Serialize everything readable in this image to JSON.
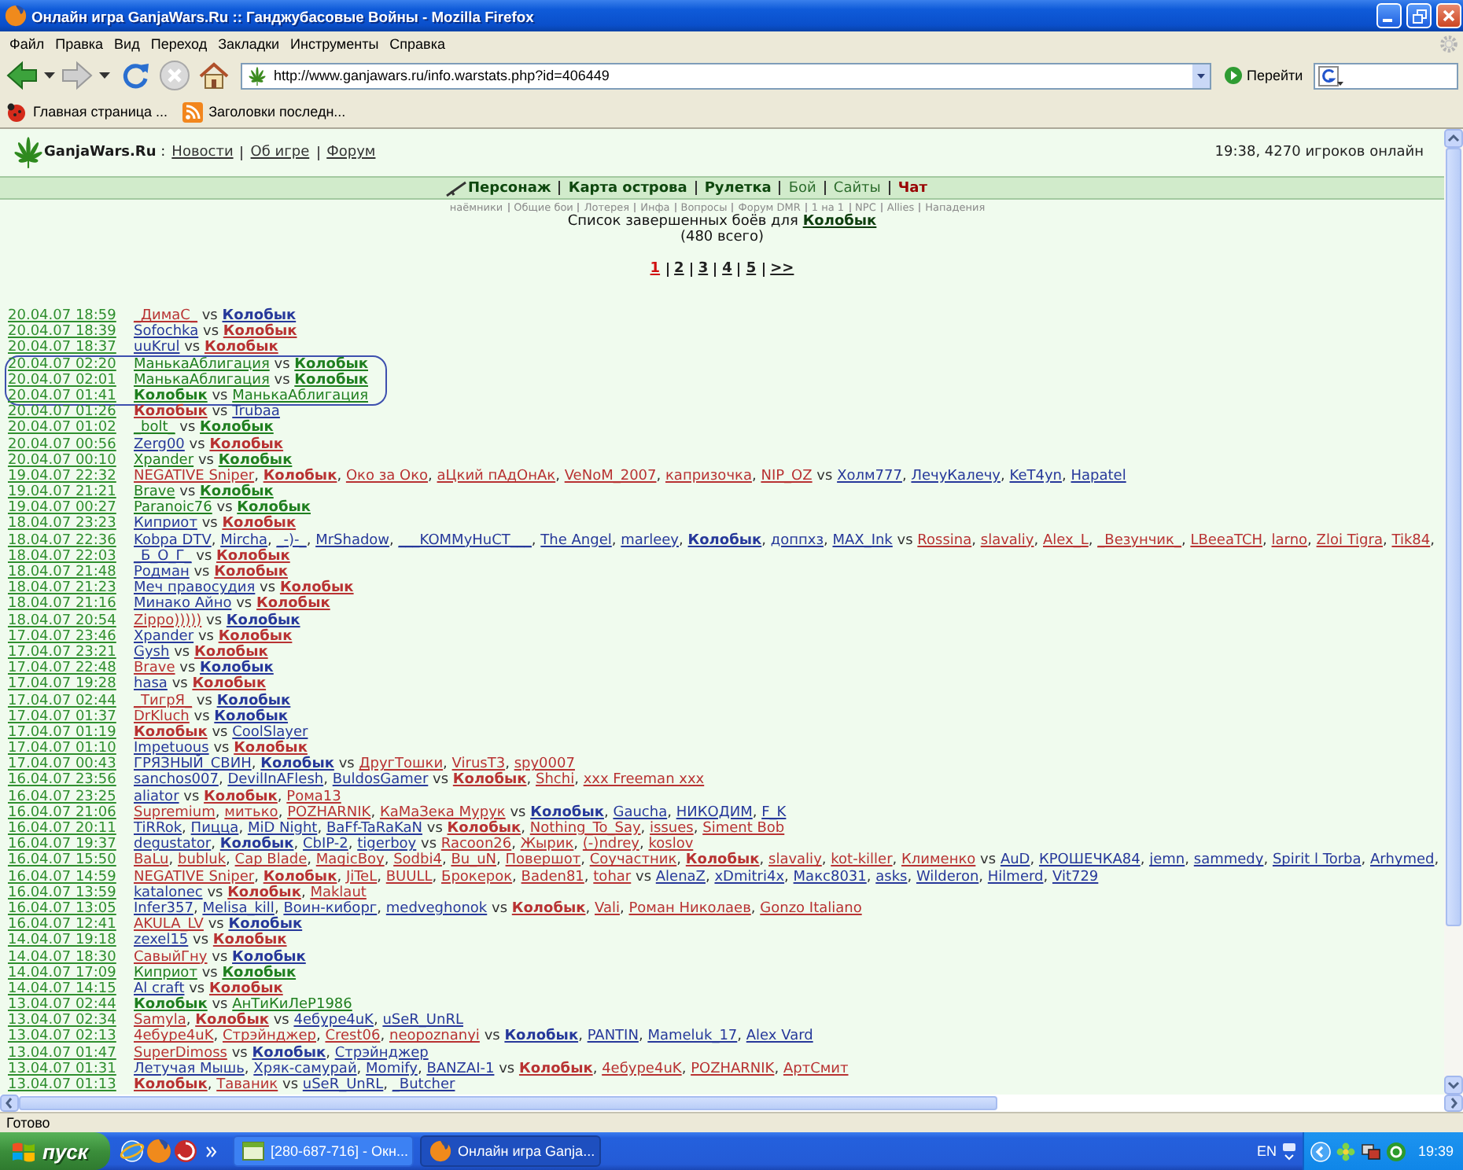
{
  "window": {
    "title": "Онлайн игра GanjaWars.Ru :: Ганджубасовые Войны - Mozilla Firefox"
  },
  "menu": [
    "Файл",
    "Правка",
    "Вид",
    "Переход",
    "Закладки",
    "Инструменты",
    "Справка"
  ],
  "toolbar": {
    "url": "http://www.ganjawars.ru/info.warstats.php?id=406449",
    "go": "Перейти"
  },
  "bookmarks": [
    {
      "label": "Главная страница ...",
      "kind": "page"
    },
    {
      "label": "Заголовки последн...",
      "kind": "feed"
    }
  ],
  "header": {
    "brand": "**GanjaWars.Ru** :",
    "links": [
      "Новости",
      "Об игре",
      "Форум"
    ],
    "online": "19:38, 4270 игроков онлайн"
  },
  "nav": [
    {
      "label": "Персонаж",
      "bold": true,
      "color": "#0e470e"
    },
    {
      "label": "Карта острова",
      "bold": true,
      "color": "#0e470e"
    },
    {
      "label": "Рулетка",
      "bold": true,
      "color": "#0e470e"
    },
    {
      "label": "Бой",
      "bold": false,
      "color": "#2b6b2b"
    },
    {
      "label": "Сайты",
      "bold": false,
      "color": "#2b6b2b"
    },
    {
      "label": "Чат",
      "bold": true,
      "color": "#990000"
    }
  ],
  "subnav": [
    "наёмники",
    "Общие бои",
    "Лотерея",
    "Инфа",
    "Вопросы",
    "Форум DMR",
    "1 на 1",
    "NPC",
    "Allies",
    "Нападения"
  ],
  "list_title": {
    "text": "Список завершенных боёв для",
    "player": "Колобык"
  },
  "total": "(480 всего)",
  "pages": [
    {
      "label": "1",
      "selected": true
    },
    {
      "label": "2",
      "selected": false
    },
    {
      "label": "3",
      "selected": false
    },
    {
      "label": "4",
      "selected": false
    },
    {
      "label": "5",
      "selected": false
    },
    {
      "label": ">>",
      "selected": false
    }
  ],
  "battles": [
    {
      "date": "20.04.07 18:59",
      "circled": false,
      "team_1": [
        {
          "name": "_ДимаС_",
          "color": "#b83232",
          "bold": false
        }
      ],
      "vs": "vs",
      "team_2": [
        {
          "name": "Колобык",
          "color": "#26389a",
          "bold": true
        }
      ]
    },
    {
      "date": "20.04.07 18:39",
      "circled": false,
      "team_1": [
        {
          "name": "Sofochka",
          "color": "#26389a",
          "bold": false
        }
      ],
      "vs": "vs",
      "team_2": [
        {
          "name": "Колобык",
          "color": "#b83232",
          "bold": true
        }
      ]
    },
    {
      "date": "20.04.07 18:37",
      "circled": false,
      "team_1": [
        {
          "name": "uuKrul",
          "color": "#26389a",
          "bold": false
        }
      ],
      "vs": "vs",
      "team_2": [
        {
          "name": "Колобык",
          "color": "#b83232",
          "bold": true
        }
      ]
    },
    {
      "date": "20.04.07 02:20",
      "circled": true,
      "team_1": [
        {
          "name": "МанькаАблигация",
          "color": "#1f7f1f",
          "bold": false
        }
      ],
      "vs": "vs",
      "team_2": [
        {
          "name": "Колобык",
          "color": "#1f7f1f",
          "bold": true
        }
      ]
    },
    {
      "date": "20.04.07 02:01",
      "circled": true,
      "team_1": [
        {
          "name": "МанькаАблигация",
          "color": "#1f7f1f",
          "bold": false
        }
      ],
      "vs": "vs",
      "team_2": [
        {
          "name": "Колобык",
          "color": "#1f7f1f",
          "bold": true
        }
      ]
    },
    {
      "date": "20.04.07 01:41",
      "circled": true,
      "team_1": [
        {
          "name": "Колобык",
          "color": "#1f7f1f",
          "bold": true
        }
      ],
      "vs": "vs",
      "team_2": [
        {
          "name": "МанькаАблигация",
          "color": "#1f7f1f",
          "bold": false
        }
      ]
    },
    {
      "date": "20.04.07 01:26",
      "circled": false,
      "team_1": [
        {
          "name": "Колобык",
          "color": "#b83232",
          "bold": true
        }
      ],
      "vs": "vs",
      "team_2": [
        {
          "name": "Trubaa",
          "color": "#26389a",
          "bold": false
        }
      ]
    },
    {
      "date": "20.04.07 01:02",
      "circled": false,
      "team_1": [
        {
          "name": "_bolt_",
          "color": "#1f7f1f",
          "bold": false
        }
      ],
      "vs": "vs",
      "team_2": [
        {
          "name": "Колобык",
          "color": "#1f7f1f",
          "bold": true
        }
      ]
    },
    {
      "date": "20.04.07 00:56",
      "circled": false,
      "team_1": [
        {
          "name": "Zerg00",
          "color": "#26389a",
          "bold": false
        }
      ],
      "vs": "vs",
      "team_2": [
        {
          "name": "Колобык",
          "color": "#b83232",
          "bold": true
        }
      ]
    },
    {
      "date": "20.04.07 00:10",
      "circled": false,
      "team_1": [
        {
          "name": "Xpander",
          "color": "#1f7f1f",
          "bold": false
        }
      ],
      "vs": "vs",
      "team_2": [
        {
          "name": "Колобык",
          "color": "#1f7f1f",
          "bold": true
        }
      ]
    },
    {
      "date": "19.04.07 22:32",
      "circled": false,
      "team_1": [
        {
          "name": "NEGATIVE Sniper",
          "color": "#b83232",
          "bold": false,
          "sep": ","
        },
        {
          "name": "Колобык",
          "color": "#b83232",
          "bold": true,
          "sep": ","
        },
        {
          "name": "Око за Око",
          "color": "#b83232",
          "bold": false,
          "sep": ","
        },
        {
          "name": "аЦкий пАдОнАк",
          "color": "#b83232",
          "bold": false,
          "sep": ","
        },
        {
          "name": "VeNoM_2007",
          "color": "#b83232",
          "bold": false,
          "sep": ","
        },
        {
          "name": "капризочка",
          "color": "#b83232",
          "bold": false,
          "sep": ","
        },
        {
          "name": "NIP_OZ",
          "color": "#b83232",
          "bold": false
        }
      ],
      "vs": "vs",
      "team_2": [
        {
          "name": "Холм777",
          "color": "#26389a",
          "bold": false,
          "sep": ","
        },
        {
          "name": "ЛечуКалечу",
          "color": "#26389a",
          "bold": false,
          "sep": ","
        },
        {
          "name": "KeT4yn",
          "color": "#26389a",
          "bold": false,
          "sep": ","
        },
        {
          "name": "Hapatel",
          "color": "#26389a",
          "bold": false
        }
      ]
    },
    {
      "date": "19.04.07 21:21",
      "circled": false,
      "team_1": [
        {
          "name": "Brave",
          "color": "#1f7f1f",
          "bold": false
        }
      ],
      "vs": "vs",
      "team_2": [
        {
          "name": "Колобык",
          "color": "#1f7f1f",
          "bold": true
        }
      ]
    },
    {
      "date": "19.04.07 00:27",
      "circled": false,
      "team_1": [
        {
          "name": "Paranoic76",
          "color": "#1f7f1f",
          "bold": false
        }
      ],
      "vs": "vs",
      "team_2": [
        {
          "name": "Колобык",
          "color": "#1f7f1f",
          "bold": true
        }
      ]
    },
    {
      "date": "18.04.07 23:23",
      "circled": false,
      "team_1": [
        {
          "name": "Киприот",
          "color": "#26389a",
          "bold": false
        }
      ],
      "vs": "vs",
      "team_2": [
        {
          "name": "Колобык",
          "color": "#b83232",
          "bold": true
        }
      ]
    },
    {
      "date": "18.04.07 22:36",
      "circled": false,
      "team_1": [
        {
          "name": "Kobpa DTV",
          "color": "#26389a",
          "bold": false,
          "sep": ","
        },
        {
          "name": "Mircha",
          "color": "#26389a",
          "bold": false,
          "sep": ","
        },
        {
          "name": "_-)-_",
          "color": "#26389a",
          "bold": false,
          "sep": ","
        },
        {
          "name": "MrShadow",
          "color": "#26389a",
          "bold": false,
          "sep": ","
        },
        {
          "name": "___KOMMyHuCT___",
          "color": "#26389a",
          "bold": false,
          "sep": ","
        },
        {
          "name": "The Angel",
          "color": "#26389a",
          "bold": false,
          "sep": ","
        },
        {
          "name": "marleey",
          "color": "#26389a",
          "bold": false,
          "sep": ","
        },
        {
          "name": "Колобык",
          "color": "#26389a",
          "bold": true,
          "sep": ","
        },
        {
          "name": "доппхз",
          "color": "#26389a",
          "bold": false,
          "sep": ","
        },
        {
          "name": "MAX_Ink",
          "color": "#26389a",
          "bold": false
        }
      ],
      "vs": "vs",
      "team_2": [
        {
          "name": "Rossina",
          "color": "#b83232",
          "bold": false,
          "sep": ","
        },
        {
          "name": "slavaliy",
          "color": "#b83232",
          "bold": false,
          "sep": ","
        },
        {
          "name": "Alex_L",
          "color": "#b83232",
          "bold": false,
          "sep": ","
        },
        {
          "name": "_Везунчик_",
          "color": "#b83232",
          "bold": false,
          "sep": ","
        },
        {
          "name": "LBeeaTCH",
          "color": "#b83232",
          "bold": false,
          "sep": ","
        },
        {
          "name": "larno",
          "color": "#b83232",
          "bold": false,
          "sep": ","
        },
        {
          "name": "Zloi Tigra",
          "color": "#b83232",
          "bold": false,
          "sep": ","
        },
        {
          "name": "Tik84",
          "color": "#b83232",
          "bold": false,
          "sep": ","
        }
      ]
    },
    {
      "date": "18.04.07 22:03",
      "circled": false,
      "team_1": [
        {
          "name": "_Б_О_Г_",
          "color": "#26389a",
          "bold": false
        }
      ],
      "vs": "vs",
      "team_2": [
        {
          "name": "Колобык",
          "color": "#b83232",
          "bold": true
        }
      ]
    },
    {
      "date": "18.04.07 21:48",
      "circled": false,
      "team_1": [
        {
          "name": "Родман",
          "color": "#26389a",
          "bold": false
        }
      ],
      "vs": "vs",
      "team_2": [
        {
          "name": "Колобык",
          "color": "#b83232",
          "bold": true
        }
      ]
    },
    {
      "date": "18.04.07 21:23",
      "circled": false,
      "team_1": [
        {
          "name": "Меч правосудия",
          "color": "#26389a",
          "bold": false
        }
      ],
      "vs": "vs",
      "team_2": [
        {
          "name": "Колобык",
          "color": "#b83232",
          "bold": true
        }
      ]
    },
    {
      "date": "18.04.07 21:16",
      "circled": false,
      "team_1": [
        {
          "name": "Минако Айно",
          "color": "#26389a",
          "bold": false
        }
      ],
      "vs": "vs",
      "team_2": [
        {
          "name": "Колобык",
          "color": "#b83232",
          "bold": true
        }
      ]
    },
    {
      "date": "18.04.07 20:54",
      "circled": false,
      "team_1": [
        {
          "name": "Zippo)))))",
          "color": "#b83232",
          "bold": false
        }
      ],
      "vs": "vs",
      "team_2": [
        {
          "name": "Колобык",
          "color": "#26389a",
          "bold": true
        }
      ]
    },
    {
      "date": "17.04.07 23:46",
      "circled": false,
      "team_1": [
        {
          "name": "Xpander",
          "color": "#26389a",
          "bold": false
        }
      ],
      "vs": "vs",
      "team_2": [
        {
          "name": "Колобык",
          "color": "#b83232",
          "bold": true
        }
      ]
    },
    {
      "date": "17.04.07 23:21",
      "circled": false,
      "team_1": [
        {
          "name": "Gysh",
          "color": "#26389a",
          "bold": false
        }
      ],
      "vs": "vs",
      "team_2": [
        {
          "name": "Колобык",
          "color": "#b83232",
          "bold": true
        }
      ]
    },
    {
      "date": "17.04.07 22:48",
      "circled": false,
      "team_1": [
        {
          "name": "Brave",
          "color": "#b83232",
          "bold": false
        }
      ],
      "vs": "vs",
      "team_2": [
        {
          "name": "Колобык",
          "color": "#26389a",
          "bold": true
        }
      ]
    },
    {
      "date": "17.04.07 19:28",
      "circled": false,
      "team_1": [
        {
          "name": "hasa",
          "color": "#26389a",
          "bold": false
        }
      ],
      "vs": "vs",
      "team_2": [
        {
          "name": "Колобык",
          "color": "#b83232",
          "bold": true
        }
      ]
    },
    {
      "date": "17.04.07 02:44",
      "circled": false,
      "team_1": [
        {
          "name": "_ТигрЯ_",
          "color": "#b83232",
          "bold": false
        }
      ],
      "vs": "vs",
      "team_2": [
        {
          "name": "Колобык",
          "color": "#26389a",
          "bold": true
        }
      ]
    },
    {
      "date": "17.04.07 01:37",
      "circled": false,
      "team_1": [
        {
          "name": "DrKluch",
          "color": "#b83232",
          "bold": false
        }
      ],
      "vs": "vs",
      "team_2": [
        {
          "name": "Колобык",
          "color": "#26389a",
          "bold": true
        }
      ]
    },
    {
      "date": "17.04.07 01:19",
      "circled": false,
      "team_1": [
        {
          "name": "Колобык",
          "color": "#b83232",
          "bold": true
        }
      ],
      "vs": "vs",
      "team_2": [
        {
          "name": "CoolSlayer",
          "color": "#26389a",
          "bold": false
        }
      ]
    },
    {
      "date": "17.04.07 01:10",
      "circled": false,
      "team_1": [
        {
          "name": "Impetuous",
          "color": "#26389a",
          "bold": false
        }
      ],
      "vs": "vs",
      "team_2": [
        {
          "name": "Колобык",
          "color": "#b83232",
          "bold": true
        }
      ]
    },
    {
      "date": "17.04.07 00:43",
      "circled": false,
      "team_1": [
        {
          "name": "ГРЯЗНЫЙ_СВИН",
          "color": "#26389a",
          "bold": false,
          "sep": ","
        },
        {
          "name": "Колобык",
          "color": "#26389a",
          "bold": true
        }
      ],
      "vs": "vs",
      "team_2": [
        {
          "name": "ДругТошки",
          "color": "#b83232",
          "bold": false,
          "sep": ","
        },
        {
          "name": "VirusT3",
          "color": "#b83232",
          "bold": false,
          "sep": ","
        },
        {
          "name": "spy0007",
          "color": "#b83232",
          "bold": false
        }
      ]
    },
    {
      "date": "16.04.07 23:56",
      "circled": false,
      "team_1": [
        {
          "name": "sanchos007",
          "color": "#26389a",
          "bold": false,
          "sep": ","
        },
        {
          "name": "DevilInAFlesh",
          "color": "#26389a",
          "bold": false,
          "sep": ","
        },
        {
          "name": "BuldosGamer",
          "color": "#26389a",
          "bold": false
        }
      ],
      "vs": "vs",
      "team_2": [
        {
          "name": "Колобык",
          "color": "#b83232",
          "bold": true,
          "sep": ","
        },
        {
          "name": "Shchi",
          "color": "#b83232",
          "bold": false,
          "sep": ","
        },
        {
          "name": "xxx Freeman xxx",
          "color": "#b83232",
          "bold": false
        }
      ]
    },
    {
      "date": "16.04.07 23:25",
      "circled": false,
      "team_1": [
        {
          "name": "aliator",
          "color": "#26389a",
          "bold": false
        }
      ],
      "vs": "vs",
      "team_2": [
        {
          "name": "Колобык",
          "color": "#b83232",
          "bold": true,
          "sep": ","
        },
        {
          "name": "Рома13",
          "color": "#b83232",
          "bold": false
        }
      ]
    },
    {
      "date": "16.04.07 21:06",
      "circled": false,
      "team_1": [
        {
          "name": "Supremium",
          "color": "#b83232",
          "bold": false,
          "sep": ","
        },
        {
          "name": "митько",
          "color": "#b83232",
          "bold": false,
          "sep": ","
        },
        {
          "name": "POZHARNIK",
          "color": "#b83232",
          "bold": false,
          "sep": ","
        },
        {
          "name": "КаМаЗека Мурук",
          "color": "#b83232",
          "bold": false
        }
      ],
      "vs": "vs",
      "team_2": [
        {
          "name": "Колобык",
          "color": "#26389a",
          "bold": true,
          "sep": ","
        },
        {
          "name": "Gaucha",
          "color": "#26389a",
          "bold": false,
          "sep": ","
        },
        {
          "name": "НИКОДИМ",
          "color": "#26389a",
          "bold": false,
          "sep": ","
        },
        {
          "name": "F_K",
          "color": "#26389a",
          "bold": false
        }
      ]
    },
    {
      "date": "16.04.07 20:11",
      "circled": false,
      "team_1": [
        {
          "name": "TiRRok",
          "color": "#26389a",
          "bold": false,
          "sep": ","
        },
        {
          "name": "Пицца",
          "color": "#26389a",
          "bold": false,
          "sep": ","
        },
        {
          "name": "MiD Night",
          "color": "#26389a",
          "bold": false,
          "sep": ","
        },
        {
          "name": "BaFf-TaRaKaN",
          "color": "#26389a",
          "bold": false
        }
      ],
      "vs": "vs",
      "team_2": [
        {
          "name": "Колобык",
          "color": "#b83232",
          "bold": true,
          "sep": ","
        },
        {
          "name": "Nothing_To_Say",
          "color": "#b83232",
          "bold": false,
          "sep": ","
        },
        {
          "name": "issues",
          "color": "#b83232",
          "bold": false,
          "sep": ","
        },
        {
          "name": "Siment Bob",
          "color": "#b83232",
          "bold": false
        }
      ]
    },
    {
      "date": "16.04.07 19:37",
      "circled": false,
      "team_1": [
        {
          "name": "degustator",
          "color": "#26389a",
          "bold": false,
          "sep": ","
        },
        {
          "name": "Колобык",
          "color": "#26389a",
          "bold": true,
          "sep": ","
        },
        {
          "name": "CbIP-2",
          "color": "#26389a",
          "bold": false,
          "sep": ","
        },
        {
          "name": "tigerboy",
          "color": "#26389a",
          "bold": false
        }
      ],
      "vs": "vs",
      "team_2": [
        {
          "name": "Racoon26",
          "color": "#b83232",
          "bold": false,
          "sep": ","
        },
        {
          "name": "Жырик",
          "color": "#b83232",
          "bold": false,
          "sep": ","
        },
        {
          "name": "(-)ndrey",
          "color": "#b83232",
          "bold": false,
          "sep": ","
        },
        {
          "name": "koslov",
          "color": "#b83232",
          "bold": false
        }
      ]
    },
    {
      "date": "16.04.07 15:50",
      "circled": false,
      "team_1": [
        {
          "name": "BaLu",
          "color": "#b83232",
          "bold": false,
          "sep": ","
        },
        {
          "name": "bubluk",
          "color": "#b83232",
          "bold": false,
          "sep": ","
        },
        {
          "name": "Cap Blade",
          "color": "#b83232",
          "bold": false,
          "sep": ","
        },
        {
          "name": "MagicBoy",
          "color": "#b83232",
          "bold": false,
          "sep": ","
        },
        {
          "name": "Sodbi4",
          "color": "#b83232",
          "bold": false,
          "sep": ","
        },
        {
          "name": "Bu_uN",
          "color": "#b83232",
          "bold": false,
          "sep": ","
        },
        {
          "name": "Повершот",
          "color": "#b83232",
          "bold": false,
          "sep": ","
        },
        {
          "name": "Соучастник",
          "color": "#b83232",
          "bold": false,
          "sep": ","
        },
        {
          "name": "Колобык",
          "color": "#b83232",
          "bold": true,
          "sep": ","
        },
        {
          "name": "slavaliy",
          "color": "#b83232",
          "bold": false,
          "sep": ","
        },
        {
          "name": "kot-killer",
          "color": "#b83232",
          "bold": false,
          "sep": ","
        },
        {
          "name": "Клименко",
          "color": "#b83232",
          "bold": false
        }
      ],
      "vs": "vs",
      "team_2": [
        {
          "name": "AuD",
          "color": "#26389a",
          "bold": false,
          "sep": ","
        },
        {
          "name": "КРОШЕЧКА84",
          "color": "#26389a",
          "bold": false,
          "sep": ","
        },
        {
          "name": "jemn",
          "color": "#26389a",
          "bold": false,
          "sep": ","
        },
        {
          "name": "sammedy",
          "color": "#26389a",
          "bold": false,
          "sep": ","
        },
        {
          "name": "Spirit l Torba",
          "color": "#26389a",
          "bold": false,
          "sep": ","
        },
        {
          "name": "Arhymed",
          "color": "#26389a",
          "bold": false,
          "sep": ","
        }
      ]
    },
    {
      "date": "16.04.07 14:59",
      "circled": false,
      "team_1": [
        {
          "name": "NEGATIVE Sniper",
          "color": "#b83232",
          "bold": false,
          "sep": ","
        },
        {
          "name": "Колобык",
          "color": "#b83232",
          "bold": true,
          "sep": ","
        },
        {
          "name": "JiTeL",
          "color": "#b83232",
          "bold": false,
          "sep": ","
        },
        {
          "name": "BUULL",
          "color": "#b83232",
          "bold": false,
          "sep": ","
        },
        {
          "name": "Брокерок",
          "color": "#b83232",
          "bold": false,
          "sep": ","
        },
        {
          "name": "Baden81",
          "color": "#b83232",
          "bold": false,
          "sep": ","
        },
        {
          "name": "tohar",
          "color": "#b83232",
          "bold": false
        }
      ],
      "vs": "vs",
      "team_2": [
        {
          "name": "AlenaZ",
          "color": "#26389a",
          "bold": false,
          "sep": ","
        },
        {
          "name": "xDmitri4x",
          "color": "#26389a",
          "bold": false,
          "sep": ","
        },
        {
          "name": "Макс8031",
          "color": "#26389a",
          "bold": false,
          "sep": ","
        },
        {
          "name": "asks",
          "color": "#26389a",
          "bold": false,
          "sep": ","
        },
        {
          "name": "Wilderon",
          "color": "#26389a",
          "bold": false,
          "sep": ","
        },
        {
          "name": "Hilmerd",
          "color": "#26389a",
          "bold": false,
          "sep": ","
        },
        {
          "name": "Vit729",
          "color": "#26389a",
          "bold": false
        }
      ]
    },
    {
      "date": "16.04.07 13:59",
      "circled": false,
      "team_1": [
        {
          "name": "katalonec",
          "color": "#26389a",
          "bold": false
        }
      ],
      "vs": "vs",
      "team_2": [
        {
          "name": "Колобык",
          "color": "#b83232",
          "bold": true,
          "sep": ","
        },
        {
          "name": "Maklaut",
          "color": "#b83232",
          "bold": false
        }
      ]
    },
    {
      "date": "16.04.07 13:05",
      "circled": false,
      "team_1": [
        {
          "name": "Infer357",
          "color": "#26389a",
          "bold": false,
          "sep": ","
        },
        {
          "name": "Melisa_kill",
          "color": "#26389a",
          "bold": false,
          "sep": ","
        },
        {
          "name": "Воин-киборг",
          "color": "#26389a",
          "bold": false,
          "sep": ","
        },
        {
          "name": "medveghonok",
          "color": "#26389a",
          "bold": false
        }
      ],
      "vs": "vs",
      "team_2": [
        {
          "name": "Колобык",
          "color": "#b83232",
          "bold": true,
          "sep": ","
        },
        {
          "name": "Vali",
          "color": "#b83232",
          "bold": false,
          "sep": ","
        },
        {
          "name": "Роман Николаев",
          "color": "#b83232",
          "bold": false,
          "sep": ","
        },
        {
          "name": "Gonzo Italiano",
          "color": "#b83232",
          "bold": false
        }
      ]
    },
    {
      "date": "16.04.07 12:41",
      "circled": false,
      "team_1": [
        {
          "name": "AKULA_LV",
          "color": "#b83232",
          "bold": false
        }
      ],
      "vs": "vs",
      "team_2": [
        {
          "name": "Колобык",
          "color": "#26389a",
          "bold": true
        }
      ]
    },
    {
      "date": "14.04.07 19:18",
      "circled": false,
      "team_1": [
        {
          "name": "zexel15",
          "color": "#26389a",
          "bold": false
        }
      ],
      "vs": "vs",
      "team_2": [
        {
          "name": "Колобык",
          "color": "#b83232",
          "bold": true
        }
      ]
    },
    {
      "date": "14.04.07 18:30",
      "circled": false,
      "team_1": [
        {
          "name": "СавыйГну",
          "color": "#b83232",
          "bold": false
        }
      ],
      "vs": "vs",
      "team_2": [
        {
          "name": "Колобык",
          "color": "#26389a",
          "bold": true
        }
      ]
    },
    {
      "date": "14.04.07 17:09",
      "circled": false,
      "team_1": [
        {
          "name": "Киприот",
          "color": "#1f7f1f",
          "bold": false
        }
      ],
      "vs": "vs",
      "team_2": [
        {
          "name": "Колобык",
          "color": "#1f7f1f",
          "bold": true
        }
      ]
    },
    {
      "date": "14.04.07 14:15",
      "circled": false,
      "team_1": [
        {
          "name": "Al craft",
          "color": "#26389a",
          "bold": false
        }
      ],
      "vs": "vs",
      "team_2": [
        {
          "name": "Колобык",
          "color": "#b83232",
          "bold": true
        }
      ]
    },
    {
      "date": "13.04.07 02:44",
      "circled": false,
      "team_1": [
        {
          "name": "Колобык",
          "color": "#1f7f1f",
          "bold": true
        }
      ],
      "vs": "vs",
      "team_2": [
        {
          "name": "АнТиКиЛеР1986",
          "color": "#1f7f1f",
          "bold": false
        }
      ]
    },
    {
      "date": "13.04.07 02:34",
      "circled": false,
      "team_1": [
        {
          "name": "Samyla",
          "color": "#b83232",
          "bold": false,
          "sep": ","
        },
        {
          "name": "Колобык",
          "color": "#b83232",
          "bold": true
        }
      ],
      "vs": "vs",
      "team_2": [
        {
          "name": "4ебуре4uK",
          "color": "#26389a",
          "bold": false,
          "sep": ","
        },
        {
          "name": "uSeR_UnRL",
          "color": "#26389a",
          "bold": false
        }
      ]
    },
    {
      "date": "13.04.07 02:13",
      "circled": false,
      "team_1": [
        {
          "name": "4ебуре4uK",
          "color": "#b83232",
          "bold": false,
          "sep": ","
        },
        {
          "name": "Стрэйнджер",
          "color": "#b83232",
          "bold": false,
          "sep": ","
        },
        {
          "name": "Crest06",
          "color": "#b83232",
          "bold": false,
          "sep": ","
        },
        {
          "name": "neopoznanyi",
          "color": "#b83232",
          "bold": false
        }
      ],
      "vs": "vs",
      "team_2": [
        {
          "name": "Колобык",
          "color": "#26389a",
          "bold": true,
          "sep": ","
        },
        {
          "name": "PANTIN",
          "color": "#26389a",
          "bold": false,
          "sep": ","
        },
        {
          "name": "Mameluk_17",
          "color": "#26389a",
          "bold": false,
          "sep": ","
        },
        {
          "name": "Alex Vard",
          "color": "#26389a",
          "bold": false
        }
      ]
    },
    {
      "date": "13.04.07 01:47",
      "circled": false,
      "team_1": [
        {
          "name": "SuperDimoss",
          "color": "#b83232",
          "bold": false
        }
      ],
      "vs": "vs",
      "team_2": [
        {
          "name": "Колобык",
          "color": "#26389a",
          "bold": true,
          "sep": ","
        },
        {
          "name": "Стрэйнджер",
          "color": "#26389a",
          "bold": false
        }
      ]
    },
    {
      "date": "13.04.07 01:31",
      "circled": false,
      "team_1": [
        {
          "name": "Летучая Мышь",
          "color": "#26389a",
          "bold": false,
          "sep": ","
        },
        {
          "name": "Хряк-самурай",
          "color": "#26389a",
          "bold": false,
          "sep": ","
        },
        {
          "name": "Momify",
          "color": "#26389a",
          "bold": false,
          "sep": ","
        },
        {
          "name": "BANZAI-1",
          "color": "#26389a",
          "bold": false
        }
      ],
      "vs": "vs",
      "team_2": [
        {
          "name": "Колобык",
          "color": "#b83232",
          "bold": true,
          "sep": ","
        },
        {
          "name": "4ебуре4uK",
          "color": "#b83232",
          "bold": false,
          "sep": ","
        },
        {
          "name": "POZHARNIK",
          "color": "#b83232",
          "bold": false,
          "sep": ","
        },
        {
          "name": "АртСмит",
          "color": "#b83232",
          "bold": false
        }
      ]
    },
    {
      "date": "13.04.07 01:13",
      "circled": false,
      "team_1": [
        {
          "name": "Колобык",
          "color": "#b83232",
          "bold": true,
          "sep": ","
        },
        {
          "name": "Таваник",
          "color": "#b83232",
          "bold": false
        }
      ],
      "vs": "vs",
      "team_2": [
        {
          "name": "uSeR_UnRL",
          "color": "#26389a",
          "bold": false,
          "sep": ","
        },
        {
          "name": "_Butcher",
          "color": "#26389a",
          "bold": false
        }
      ]
    }
  ],
  "status_bar": "Готово",
  "taskbar": {
    "start": "пуск",
    "tasks": [
      {
        "label": "[280-687-716] - Окн...",
        "kind": "window",
        "selected": false
      },
      {
        "label": "Онлайн игра Ganja...",
        "kind": "browser",
        "selected": true
      }
    ],
    "language": "EN",
    "clock": "19:39"
  }
}
